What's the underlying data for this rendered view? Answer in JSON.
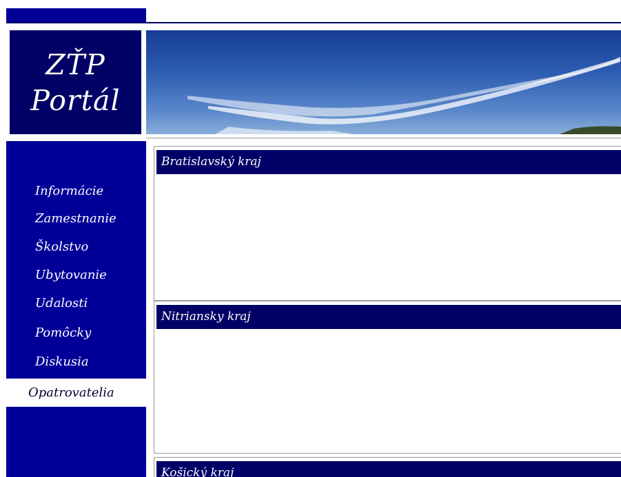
{
  "logo": {
    "line1": "ZŤP",
    "line2": "Portál"
  },
  "sidebar": {
    "items": [
      {
        "label": "Informácie",
        "active": false
      },
      {
        "label": "Zamestnanie",
        "active": false
      },
      {
        "label": "Školstvo",
        "active": false
      },
      {
        "label": "Ubytovanie",
        "active": false
      },
      {
        "label": "Udalosti",
        "active": false
      },
      {
        "label": "Pomôcky",
        "active": false
      },
      {
        "label": "Diskusia",
        "active": false
      },
      {
        "label": "Opatrovatelia",
        "active": true
      }
    ]
  },
  "main": {
    "panels": [
      {
        "title": "Bratislavský kraj"
      },
      {
        "title": "Nitriansky kraj"
      },
      {
        "title": "Košický kraj"
      }
    ]
  },
  "colors": {
    "sidebar": "#000099",
    "panel_header": "#000066",
    "logo_bg": "#000066"
  }
}
